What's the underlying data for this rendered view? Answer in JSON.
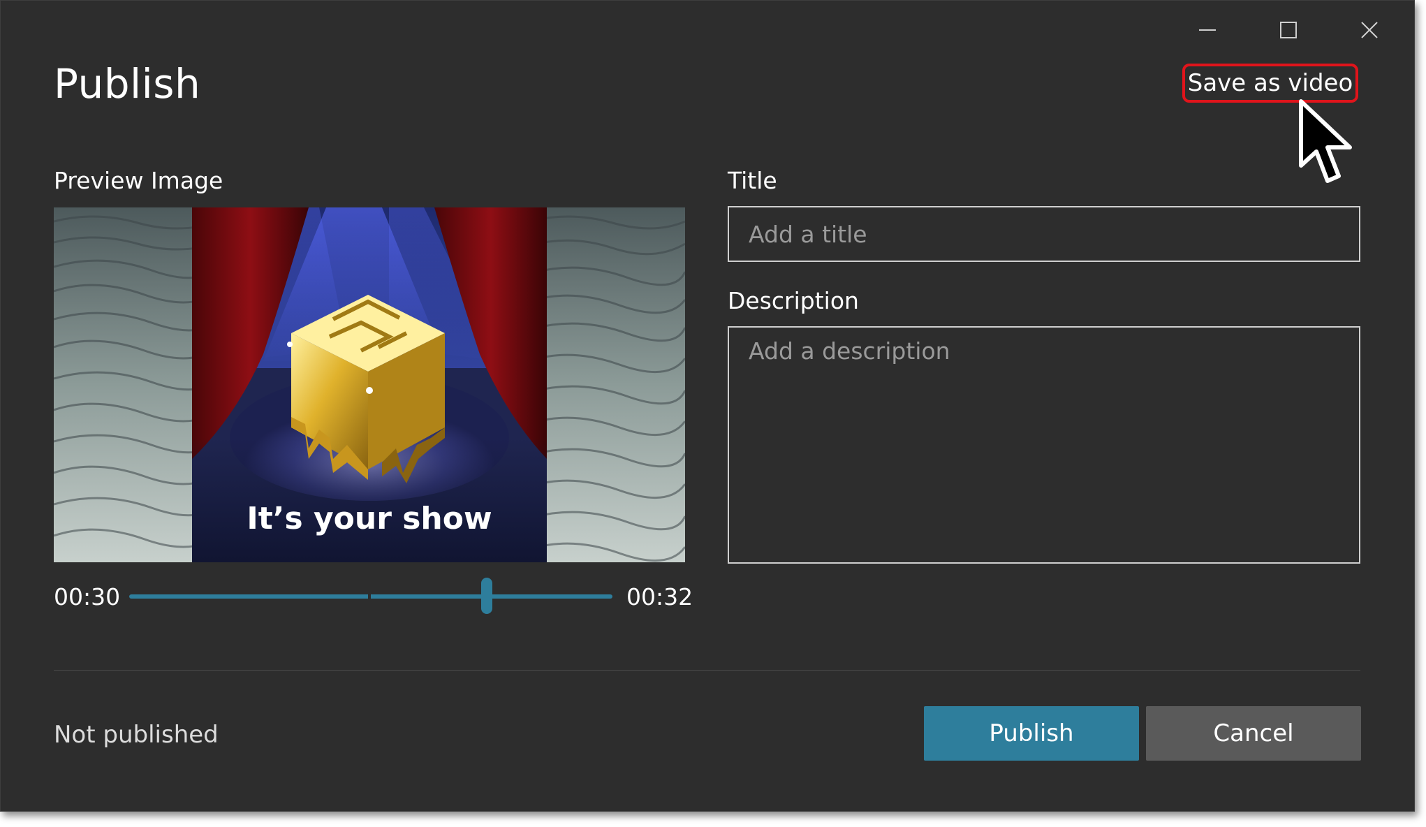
{
  "dialog": {
    "title": "Publish",
    "save_as_video_label": "Save as video"
  },
  "window_controls": {
    "minimize_icon": "minimize-icon",
    "maximize_icon": "maximize-icon",
    "close_icon": "close-icon"
  },
  "preview": {
    "label": "Preview Image",
    "overlay_text": "It’s your show",
    "slider": {
      "start_time": "00:30",
      "end_time": "00:32",
      "position": 0.74
    }
  },
  "form": {
    "title_label": "Title",
    "title_placeholder": "Add a title",
    "title_value": "",
    "description_label": "Description",
    "description_placeholder": "Add a description",
    "description_value": ""
  },
  "footer": {
    "status": "Not published",
    "publish_label": "Publish",
    "cancel_label": "Cancel"
  },
  "colors": {
    "background": "#2d2d2d",
    "accent": "#2e7e9c",
    "cancel_button": "#5a5a5a",
    "highlight": "#e0141b"
  }
}
